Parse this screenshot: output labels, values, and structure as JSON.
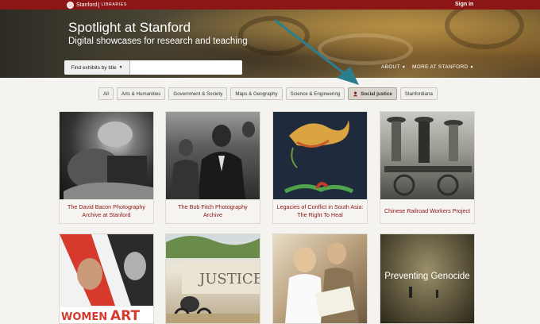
{
  "topbar": {
    "brand_name": "Stanford",
    "brand_sub": "LIBRARIES",
    "signin": "Sign in"
  },
  "hero": {
    "title": "Spotlight at Stanford",
    "subtitle": "Digital showcases for research and teaching",
    "search_button": "Find exhibits by title",
    "search_placeholder": "",
    "nav_about": "ABOUT",
    "nav_more": "MORE AT STANFORD"
  },
  "filters": [
    "All",
    "Arts & Humanities",
    "Government & Society",
    "Maps & Geography",
    "Science & Engineering",
    "Social justice",
    "Stanfordiana"
  ],
  "active_filter": "Social justice",
  "cards": [
    {
      "title": "The David Bacon Photography Archive at Stanford"
    },
    {
      "title": "The Bob Fitch Photography Archive"
    },
    {
      "title": "Legacies of Conflict in South Asia: The Right To Heal"
    },
    {
      "title": "Chinese Railroad Workers Project"
    }
  ],
  "row2": {
    "women_art_text_1": "WOMEN",
    "women_art_text_2": "ART",
    "justice_wall_text": "JUSTICE",
    "genocide_title": "Preventing Genocide"
  },
  "colors": {
    "brand": "#8c1515",
    "arrow": "#2a7f8f",
    "background": "#f4f3ef"
  }
}
